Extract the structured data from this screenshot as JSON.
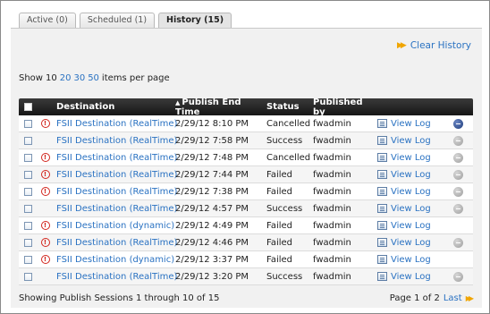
{
  "tabs": [
    {
      "label": "Active (0)"
    },
    {
      "label": "Scheduled (1)"
    },
    {
      "label": "History (15)"
    }
  ],
  "clear_history": "Clear History",
  "per_page": {
    "prefix": "Show",
    "current": "10",
    "options": [
      "20",
      "30",
      "50"
    ],
    "suffix": "items per page"
  },
  "columns": {
    "destination": "Destination",
    "publish_end_time": "Publish End Time",
    "status": "Status",
    "published_by": "Published by"
  },
  "sort_indicator": "▲",
  "rows": [
    {
      "warning": true,
      "destination": "FSII Destination (RealTime)",
      "time": "2/29/12 8:10 PM",
      "status": "Cancelled",
      "by": "fwadmin",
      "log": "View Log",
      "action": "blue"
    },
    {
      "warning": false,
      "destination": "FSII Destination (RealTime)",
      "time": "2/29/12 7:58 PM",
      "status": "Success",
      "by": "fwadmin",
      "log": "View Log",
      "action": "grey"
    },
    {
      "warning": true,
      "destination": "FSII Destination (RealTime)",
      "time": "2/29/12 7:48 PM",
      "status": "Cancelled",
      "by": "fwadmin",
      "log": "View Log",
      "action": "grey"
    },
    {
      "warning": true,
      "destination": "FSII Destination (RealTime)",
      "time": "2/29/12 7:44 PM",
      "status": "Failed",
      "by": "fwadmin",
      "log": "View Log",
      "action": "grey"
    },
    {
      "warning": true,
      "destination": "FSII Destination (RealTime)",
      "time": "2/29/12 7:38 PM",
      "status": "Failed",
      "by": "fwadmin",
      "log": "View Log",
      "action": "grey"
    },
    {
      "warning": false,
      "destination": "FSII Destination (RealTime)",
      "time": "2/29/12 4:57 PM",
      "status": "Success",
      "by": "fwadmin",
      "log": "View Log",
      "action": "grey"
    },
    {
      "warning": true,
      "destination": "FSII Destination (dynamic)",
      "time": "2/29/12 4:49 PM",
      "status": "Failed",
      "by": "fwadmin",
      "log": "View Log",
      "action": "none"
    },
    {
      "warning": true,
      "destination": "FSII Destination (RealTime)",
      "time": "2/29/12 4:46 PM",
      "status": "Failed",
      "by": "fwadmin",
      "log": "View Log",
      "action": "grey"
    },
    {
      "warning": true,
      "destination": "FSII Destination (dynamic)",
      "time": "2/29/12 3:37 PM",
      "status": "Failed",
      "by": "fwadmin",
      "log": "View Log",
      "action": "none"
    },
    {
      "warning": false,
      "destination": "FSII Destination (RealTime)",
      "time": "2/29/12 3:20 PM",
      "status": "Success",
      "by": "fwadmin",
      "log": "View Log",
      "action": "grey"
    }
  ],
  "footer": {
    "showing": "Showing Publish Sessions 1 through 10 of 15",
    "page": "Page 1 of 2",
    "last": "Last"
  },
  "colors": {
    "link": "#2a72c2",
    "header_bg": "#161616",
    "warning": "#d2261e",
    "accent_arrow": "#f0a500",
    "action_active": "#1d3b7a",
    "action_inactive": "#9d9d9d"
  },
  "icons": {
    "clear_history": "fast-forward-icon",
    "warning": "exclamation-circle-icon",
    "log": "log-document-icon",
    "action": "minus-circle-icon",
    "last_page": "fast-forward-icon"
  }
}
